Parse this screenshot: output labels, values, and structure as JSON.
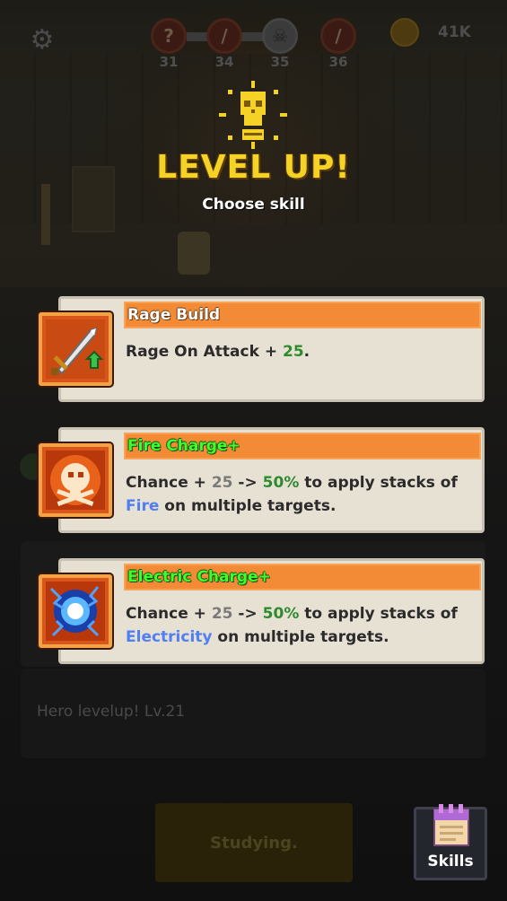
{
  "top_bar": {
    "stages": [
      {
        "number": "31",
        "icon": "question-icon"
      },
      {
        "number": "34",
        "icon": "sword-icon"
      },
      {
        "number": "35",
        "icon": "skull-icon"
      },
      {
        "number": "36",
        "icon": "sword-icon"
      }
    ],
    "gold": "41K"
  },
  "level_up": {
    "title": "LEVEL UP!",
    "subtitle": "Choose skill"
  },
  "skills": [
    {
      "name": "Rage Build",
      "icon": "sword-upgrade-icon",
      "desc_parts": [
        "Rage On Attack + ",
        "25",
        "."
      ]
    },
    {
      "name": "Fire Charge+",
      "icon": "fire-skull-icon",
      "desc_parts": [
        "Chance + ",
        "25",
        " -> ",
        "50%",
        " to apply stacks of ",
        "Fire",
        " on multiple targets."
      ]
    },
    {
      "name": "Electric Charge+",
      "icon": "electric-orb-icon",
      "desc_parts": [
        "Chance + ",
        "25",
        " -> ",
        "50%",
        " to apply stacks of ",
        "Electricity",
        " on multiple targets."
      ]
    }
  ],
  "log": {
    "message": "Hero levelup! Lv.21"
  },
  "bottom": {
    "study_label": "Studying.",
    "skills_label": "Skills"
  },
  "colors": {
    "title_yellow": "#f4d226",
    "card_header_orange": "#f28a36",
    "value_green": "#2e8a2e",
    "element_blue": "#4f7ff2",
    "new_skill_green": "#3dff2e"
  }
}
